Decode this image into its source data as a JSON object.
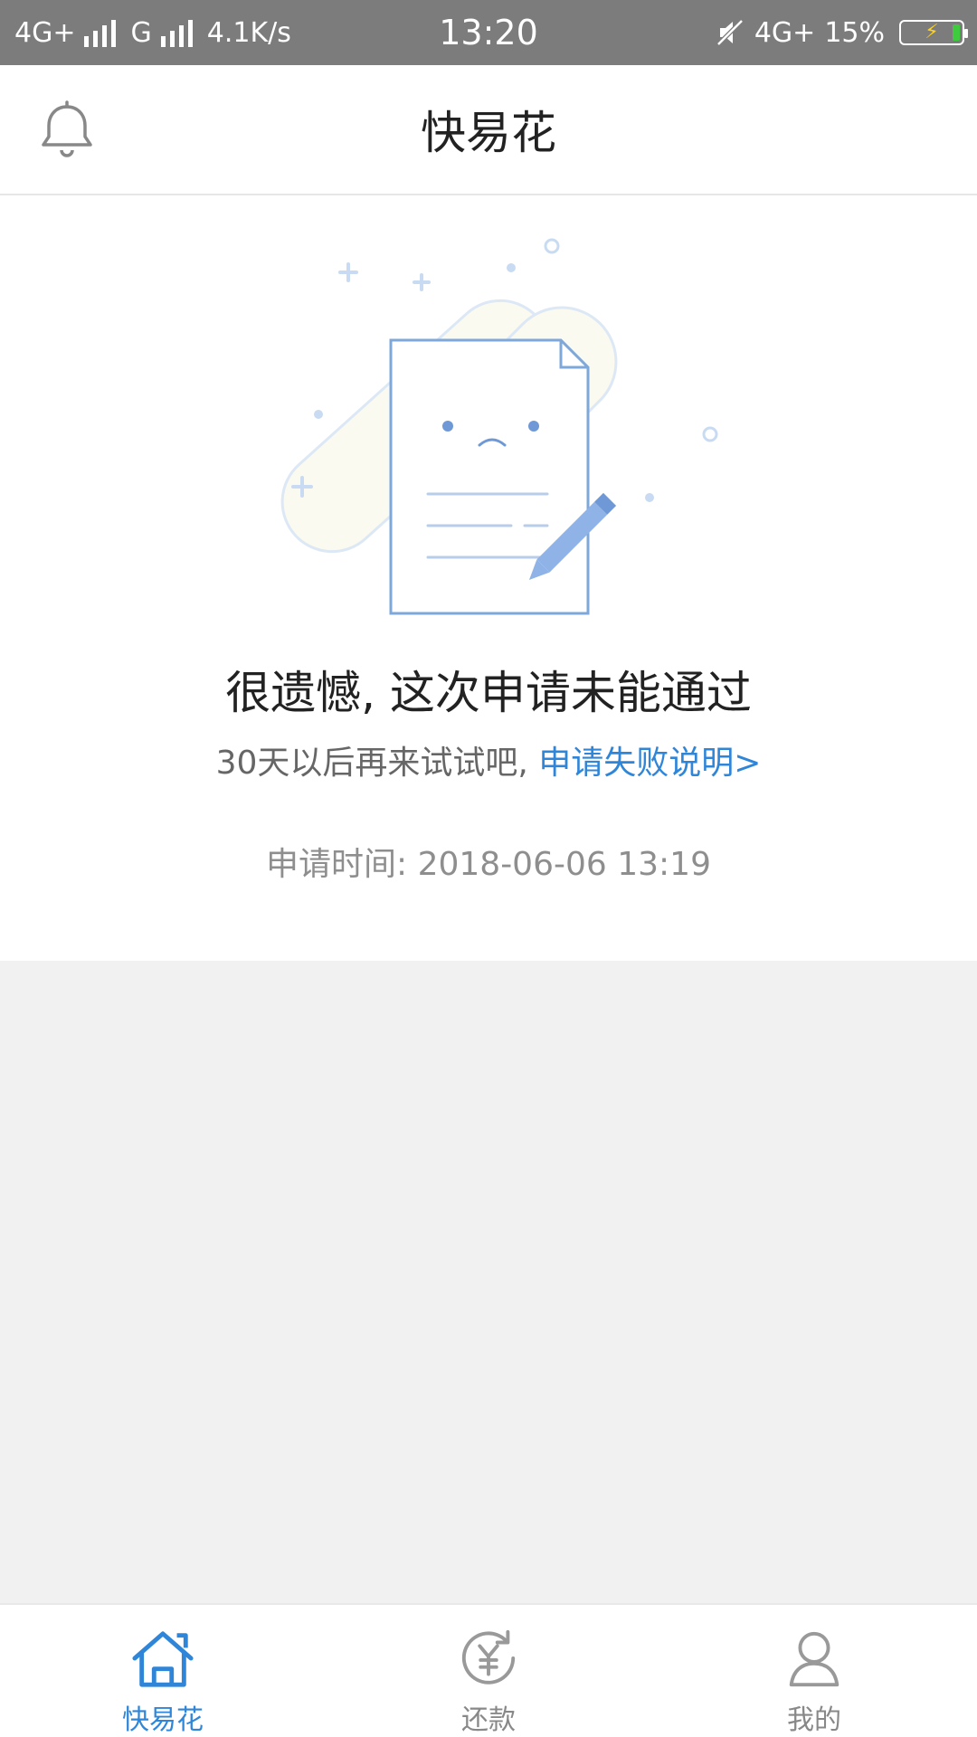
{
  "status_bar": {
    "left_network_1": "4G+",
    "left_network_2": "G",
    "speed": "4.1K/s",
    "time": "13:20",
    "right_network": "4G+",
    "battery": "15%"
  },
  "header": {
    "title": "快易花",
    "bell_icon": "bell-icon"
  },
  "result": {
    "headline": "很遗憾, 这次申请未能通过",
    "subline_text": "30天以后再来试试吧, ",
    "subline_link": "申请失败说明>",
    "apply_time": "申请时间: 2018-06-06 13:19"
  },
  "bottom_nav": {
    "items": [
      {
        "label": "快易花",
        "icon": "home-icon",
        "active": true
      },
      {
        "label": "还款",
        "icon": "repay-icon",
        "active": false
      },
      {
        "label": "我的",
        "icon": "user-icon",
        "active": false
      }
    ]
  },
  "colors": {
    "accent": "#2f86d9",
    "status_bar": "#7c7c7c",
    "background": "#f1f1f1"
  }
}
